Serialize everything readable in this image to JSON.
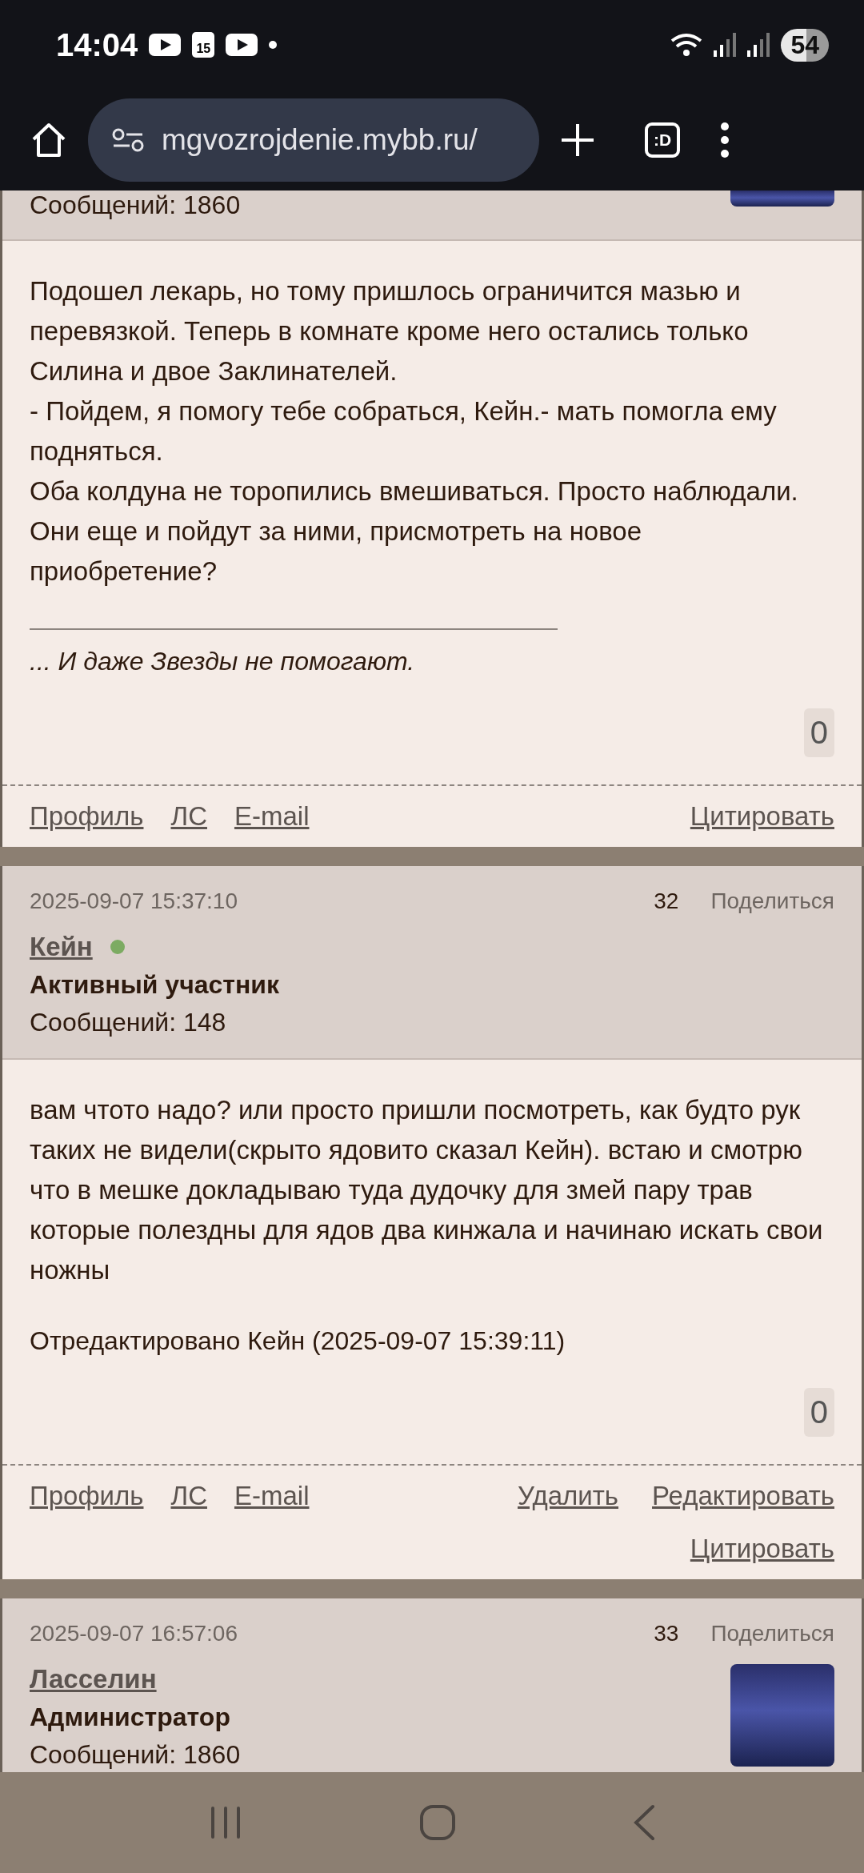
{
  "status_bar": {
    "time": "14:04",
    "calendar_day": "15",
    "battery": "54"
  },
  "browser": {
    "url": "mgvozrojdenie.mybb.ru/",
    "tab_switcher": ":D"
  },
  "posts": [
    {
      "header": {
        "messages": "Сообщений: 1860",
        "avatar": true
      },
      "body": {
        "lines": [
          "Подошел лекарь, но тому пришлось ограничится мазью и перевязкой. Теперь в комнате кроме него остались только Силина и двое Заклинателей.",
          "- Пойдем, я помогу тебе собраться, Кейн.- мать помогла ему подняться.",
          "Оба колдуна не торопились вмешиваться. Просто наблюдали. Они еще и пойдут за ними, присмотреть на новое приобретение?"
        ],
        "signature": "... И даже Звезды не помогают."
      },
      "likes": "0",
      "links_left": [
        "Профиль",
        "ЛС",
        "E-mail"
      ],
      "links_right": [
        "Цитировать"
      ]
    },
    {
      "header": {
        "date": "2025-09-07 15:37:10",
        "number": "32",
        "share": "Поделиться",
        "author": "Кейн",
        "online": true,
        "rank": "Активный участник",
        "messages": "Сообщений: 148",
        "avatar": false
      },
      "body": {
        "lines": [
          "вам чтото надо? или просто пришли посмотреть, как будто рук таких не видели(скрыто ядовито сказал Кейн). встаю и смотрю что в мешке докладываю туда дудочку для змей пару трав которые полездны для ядов два кинжала и начинаю искать свои ножны"
        ],
        "edited": "Отредактировано Кейн (2025-09-07 15:39:11)"
      },
      "likes": "0",
      "links_left": [
        "Профиль",
        "ЛС",
        "E-mail"
      ],
      "links_right": [
        "Удалить",
        "Редактировать",
        "Цитировать"
      ]
    },
    {
      "header": {
        "date": "2025-09-07 16:57:06",
        "number": "33",
        "share": "Поделиться",
        "author": "Ласселин",
        "online": false,
        "rank": "Администратор",
        "messages": "Сообщений: 1860",
        "avatar": true
      }
    }
  ]
}
